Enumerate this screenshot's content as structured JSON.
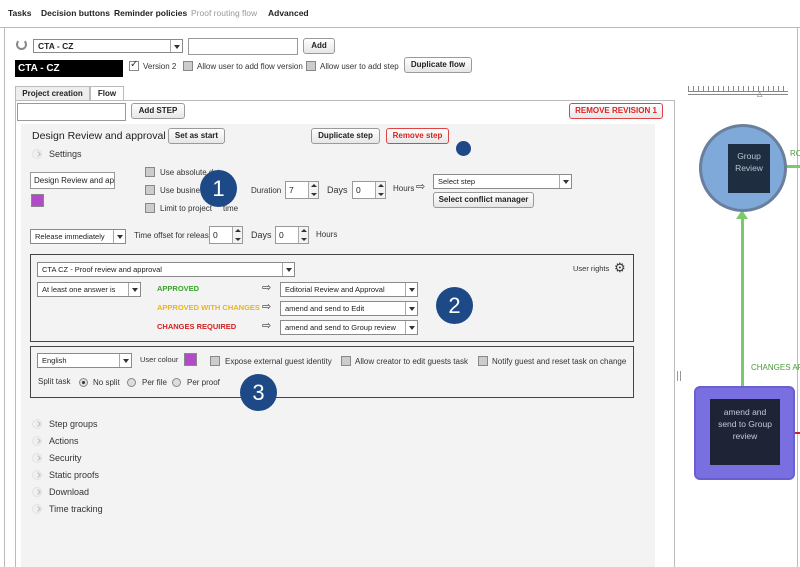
{
  "top_nav": {
    "tasks": "Tasks",
    "decision_buttons": "Decision buttons",
    "reminder_policies": "Reminder policies",
    "proof_routing_flow": "Proof routing flow",
    "advanced": "Advanced"
  },
  "flow_bar": {
    "flow_select": "CTA - CZ",
    "name_input": "",
    "add": "Add",
    "flow_name_badge": "CTA - CZ",
    "version": "Version 2",
    "allow_add_flow_version": "Allow user to add flow version",
    "allow_add_step": "Allow user to add step",
    "duplicate_flow": "Duplicate flow"
  },
  "tabs": {
    "project_creation": "Project creation",
    "flow": "Flow"
  },
  "toolbar": {
    "add_step": "Add STEP",
    "remove_revision": "REMOVE REVISION 1"
  },
  "step": {
    "title": "Design Review and approval",
    "set_as_start": "Set as start",
    "duplicate_step": "Duplicate step",
    "remove_step": "Remove step",
    "settings": "Settings",
    "name_input": "Design Review and ap",
    "color": "#b04cc8",
    "use_absolute_date": "Use absolute date",
    "use_business": "Use business",
    "limit_to_project": "Limit to project",
    "limit_to_project_tail": "time",
    "duration_label": "Duration",
    "duration_value": "7",
    "days_label": "Days",
    "days_value": "0",
    "hours_label": "Hours",
    "select_step": "Select step",
    "select_conflict_manager": "Select conflict manager",
    "release_select": "Release immediately",
    "time_offset_label": "Time offset for release",
    "offset_days_value": "0",
    "offset_days_label": "Days",
    "offset_hours_value": "0",
    "offset_hours_label": "Hours"
  },
  "decision": {
    "template_select": "CTA CZ - Proof review and approval",
    "user_rights": "User rights",
    "rule_select": "At least one answer is",
    "approved": "APPROVED",
    "approved_color": "#3aa52a",
    "approved_target": "Editorial Review and Approval",
    "with_changes": "APPROVED WITH CHANGES",
    "with_changes_color": "#e8b422",
    "with_changes_target": "amend and send to Edit",
    "changes_required": "CHANGES REQUIRED",
    "changes_required_color": "#d42020",
    "changes_required_target": "amend and send to Group review"
  },
  "guest": {
    "language": "English",
    "user_colour": "User colour",
    "user_colour_value": "#b04cc8",
    "expose": "Expose external guest identity",
    "allow_creator": "Allow creator to edit guests task",
    "notify": "Notify guest and reset task on change",
    "split_task": "Split task",
    "no_split": "No split",
    "per_file": "Per file",
    "per_proof": "Per proof"
  },
  "sections": [
    "Step groups",
    "Actions",
    "Security",
    "Static proofs",
    "Download",
    "Time tracking"
  ],
  "callouts": [
    "1",
    "2",
    "3"
  ],
  "graph": {
    "node1": [
      "Group",
      "Review"
    ],
    "node2": [
      "amend and",
      "send to Group",
      "review"
    ],
    "edge_label_top": "RO",
    "edge_label_mid": "CHANGES AP",
    "node1_color": "#7fa9d8",
    "node2_color": "#7a6fe0",
    "edge_color": "#7ac96a"
  }
}
